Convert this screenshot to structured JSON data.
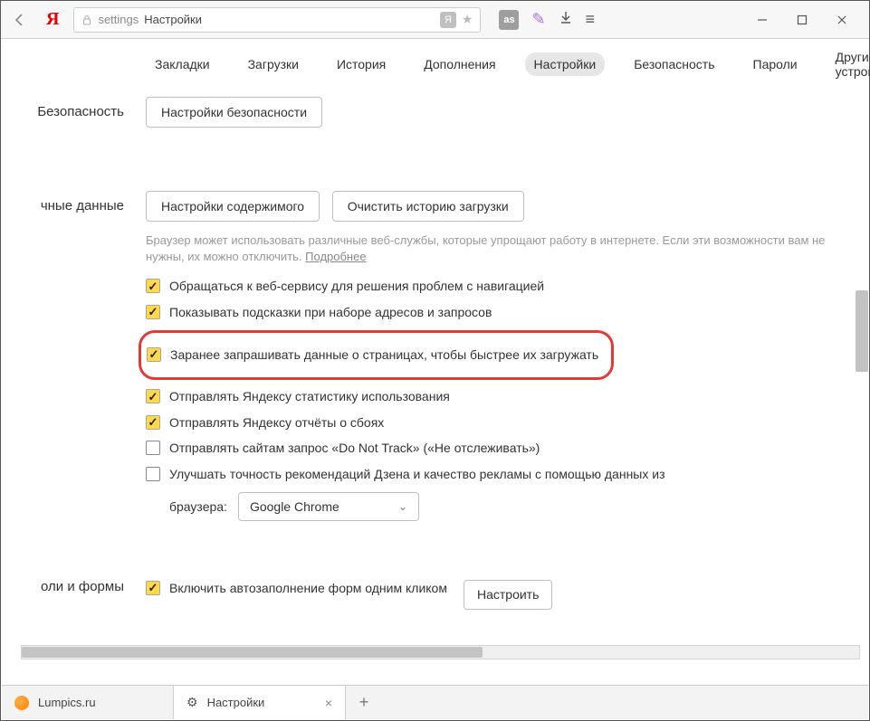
{
  "chrome": {
    "address_prefix": "settings",
    "address_title": "Настройки",
    "badge_letter": "Я",
    "ext_label": "as"
  },
  "tabs": {
    "items": [
      {
        "label": "Закладки",
        "active": false
      },
      {
        "label": "Загрузки",
        "active": false
      },
      {
        "label": "История",
        "active": false
      },
      {
        "label": "Дополнения",
        "active": false
      },
      {
        "label": "Настройки",
        "active": true
      },
      {
        "label": "Безопасность",
        "active": false
      },
      {
        "label": "Пароли",
        "active": false
      },
      {
        "label": "Другие устройства",
        "active": false
      }
    ]
  },
  "sections": {
    "security": {
      "label": "Безопасность",
      "button": "Настройки безопасности"
    },
    "personal": {
      "label": "чные данные",
      "btn_content": "Настройки содержимого",
      "btn_clear": "Очистить историю загрузки",
      "help_text": "Браузер может использовать различные веб-службы, которые упрощают работу в интернете. Если эти возможности вам не нужны, их можно отключить. ",
      "help_link": "Подробнее",
      "checks": [
        {
          "checked": true,
          "highlight": false,
          "label": "Обращаться к веб-сервису для решения проблем с навигацией"
        },
        {
          "checked": true,
          "highlight": false,
          "label": "Показывать подсказки при наборе адресов и запросов"
        },
        {
          "checked": true,
          "highlight": true,
          "label": "Заранее запрашивать данные о страницах, чтобы быстрее их загружать"
        },
        {
          "checked": true,
          "highlight": false,
          "label": "Отправлять Яндексу статистику использования"
        },
        {
          "checked": true,
          "highlight": false,
          "label": "Отправлять Яндексу отчёты о сбоях"
        },
        {
          "checked": false,
          "highlight": false,
          "label": "Отправлять сайтам запрос «Do Not Track» («Не отслеживать»)"
        },
        {
          "checked": false,
          "highlight": false,
          "label": "Улучшать точность рекомендаций Дзена и качество рекламы с помощью данных из"
        }
      ],
      "browser_label": "браузера:",
      "browser_select": "Google Chrome"
    },
    "forms": {
      "label": "оли и формы",
      "check_label": "Включить автозаполнение форм одним кликом",
      "check_checked": true,
      "config_btn": "Настроить"
    }
  },
  "tabbar": {
    "tabs": [
      {
        "label": "Lumpics.ru",
        "icon": "orange",
        "active": false
      },
      {
        "label": "Настройки",
        "icon": "gear",
        "active": true
      }
    ]
  }
}
